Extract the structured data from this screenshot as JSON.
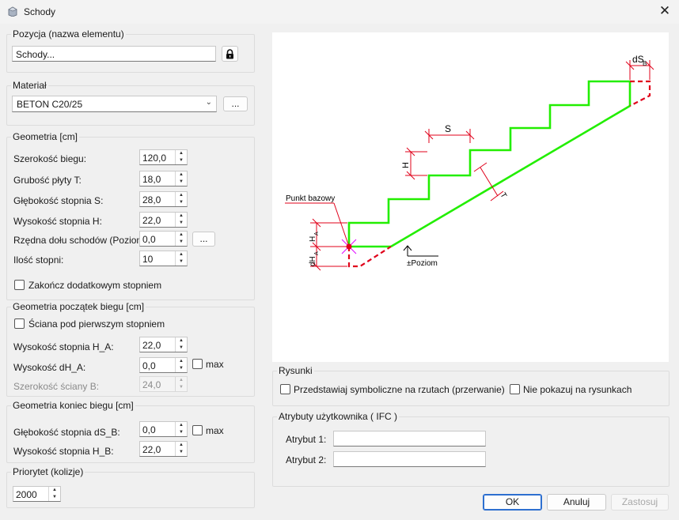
{
  "window": {
    "title": "Schody",
    "close_glyph": "✕"
  },
  "pozycja": {
    "legend": "Pozycja (nazwa elementu)",
    "value": "Schody..."
  },
  "material": {
    "legend": "Materiał",
    "value": "BETON C20/25",
    "browse_label": "..."
  },
  "geometria": {
    "legend": "Geometria [cm]",
    "szerokosc_label": "Szerokość biegu:",
    "szerokosc_value": "120,0",
    "grubosc_label": "Grubość płyty T:",
    "grubosc_value": "18,0",
    "glebokosc_label": "Głębokość stopnia S:",
    "glebokosc_value": "28,0",
    "wysokosc_label": "Wysokość stopnia H:",
    "wysokosc_value": "22,0",
    "rzedna_label": "Rzędna dołu schodów (Poziom):",
    "rzedna_value": "0,0",
    "rzedna_browse": "...",
    "ilosc_label": "Ilość stopni:",
    "ilosc_value": "10",
    "zakoncz_label": "Zakończ dodatkowym stopniem"
  },
  "poczatek": {
    "legend": "Geometria początek biegu [cm]",
    "sciana_label": "Ściana pod pierwszym stopniem",
    "wys_ha_label": "Wysokość stopnia H_A:",
    "wys_ha_value": "22,0",
    "wys_dha_label": "Wysokość dH_A:",
    "wys_dha_value": "0,0",
    "max_label": "max",
    "szer_sciany_label": "Szerokość ściany B:",
    "szer_sciany_value": "24,0"
  },
  "koniec": {
    "legend": "Geometria koniec biegu [cm]",
    "gleb_dsb_label": "Głębokość stopnia dS_B:",
    "gleb_dsb_value": "0,0",
    "max_label": "max",
    "wys_hb_label": "Wysokość stopnia H_B:",
    "wys_hb_value": "22,0"
  },
  "priorytet": {
    "legend": "Priorytet (kolizje)",
    "value": "2000"
  },
  "diagram": {
    "s_label": "S",
    "h_label": "H",
    "t_label": "T",
    "ds_label": "dS",
    "ds_sub": "B",
    "ha_label": "H",
    "ha_sub": "A",
    "dha_label": "dH",
    "dha_sub": "A",
    "punkt_label": "Punkt bazowy",
    "poziom_label": "±Poziom"
  },
  "rysunki": {
    "legend": "Rysunki",
    "symboliczne_label": "Przedstawiaj symboliczne na rzutach (przerwanie)",
    "nie_pokazuj_label": "Nie pokazuj na rysunkach"
  },
  "atrybuty": {
    "legend": "Atrybuty użytkownika ( IFC )",
    "atr1_label": "Atrybut 1:",
    "atr1_value": "",
    "atr2_label": "Atrybut 2:",
    "atr2_value": ""
  },
  "buttons": {
    "ok": "OK",
    "anuluj": "Anuluj",
    "zastosuj": "Zastosuj"
  },
  "colors": {
    "stair_line": "#22ee00",
    "dashed_red": "#e0001a",
    "primary_border": "#2d6fd0"
  }
}
